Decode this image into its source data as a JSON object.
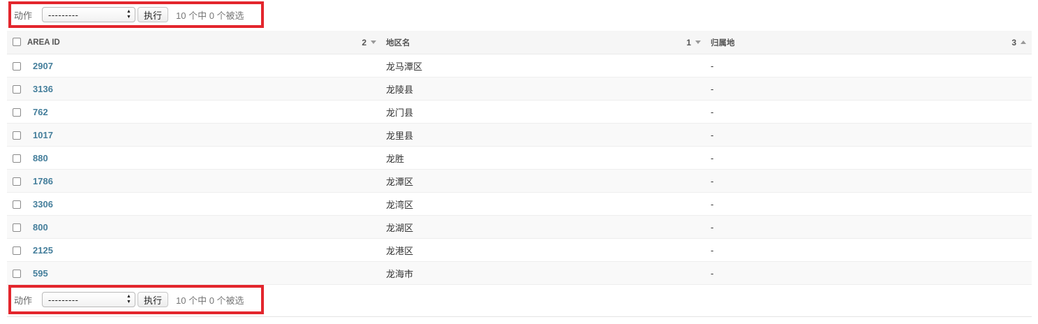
{
  "actions": {
    "label": "动作",
    "select_value": "---------",
    "go_label": "执行",
    "counter": "10 个中 0 个被选",
    "highlight_color": "#e3262d"
  },
  "table": {
    "columns": [
      {
        "label": "AREA ID",
        "sort_priority": "2",
        "sort_dir": "desc"
      },
      {
        "label": "地区名",
        "sort_priority": "1",
        "sort_dir": "desc"
      },
      {
        "label": "归属地",
        "sort_priority": "3",
        "sort_dir": "asc"
      }
    ],
    "rows": [
      {
        "id": "2907",
        "name": "龙马潭区",
        "owner": "-"
      },
      {
        "id": "3136",
        "name": "龙陵县",
        "owner": "-"
      },
      {
        "id": "762",
        "name": "龙门县",
        "owner": "-"
      },
      {
        "id": "1017",
        "name": "龙里县",
        "owner": "-"
      },
      {
        "id": "880",
        "name": "龙胜",
        "owner": "-"
      },
      {
        "id": "1786",
        "name": "龙潭区",
        "owner": "-"
      },
      {
        "id": "3306",
        "name": "龙湾区",
        "owner": "-"
      },
      {
        "id": "800",
        "name": "龙湖区",
        "owner": "-"
      },
      {
        "id": "2125",
        "name": "龙港区",
        "owner": "-"
      },
      {
        "id": "595",
        "name": "龙海市",
        "owner": "-"
      }
    ],
    "link_color": "#447e9b"
  },
  "icons": {
    "select_arrows": "updown-arrows-icon",
    "sort_desc": "triangle-down-icon",
    "sort_asc": "triangle-up-icon",
    "checkbox": "checkbox-icon"
  }
}
